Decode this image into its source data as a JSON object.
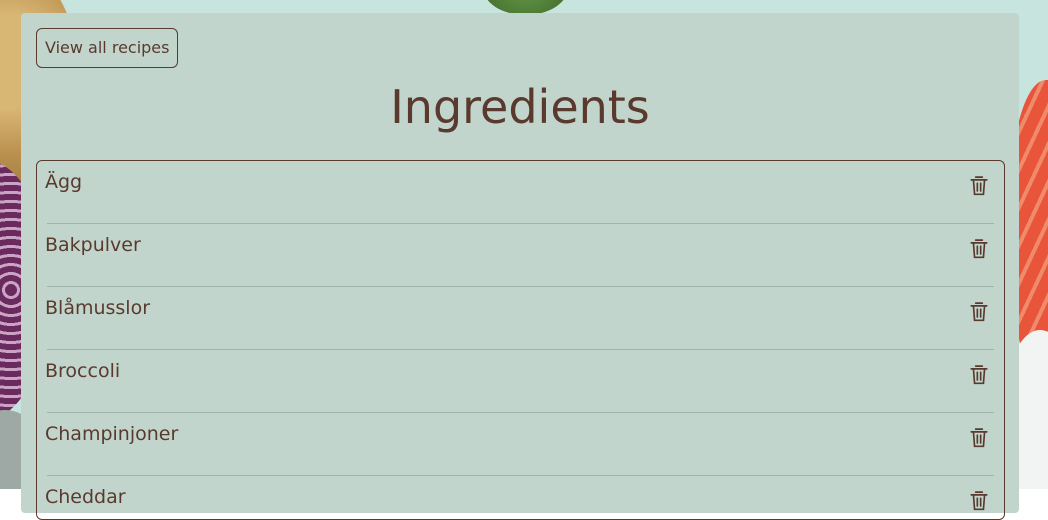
{
  "page": {
    "view_all_label": "View all recipes",
    "title": "Ingredients"
  },
  "ingredients": [
    {
      "name": "Ägg",
      "action_icon": "trash-icon"
    },
    {
      "name": "Bakpulver",
      "action_icon": "trash-icon"
    },
    {
      "name": "Blåmusslor",
      "action_icon": "trash-icon"
    },
    {
      "name": "Broccoli",
      "action_icon": "trash-icon"
    },
    {
      "name": "Champinjoner",
      "action_icon": "trash-icon"
    },
    {
      "name": "Cheddar",
      "action_icon": "trash-icon"
    }
  ],
  "colors": {
    "text": "#5a3a2e",
    "panel": "#c2d5cc",
    "background": "#c8e4de",
    "divider": "#a3b3ab"
  }
}
